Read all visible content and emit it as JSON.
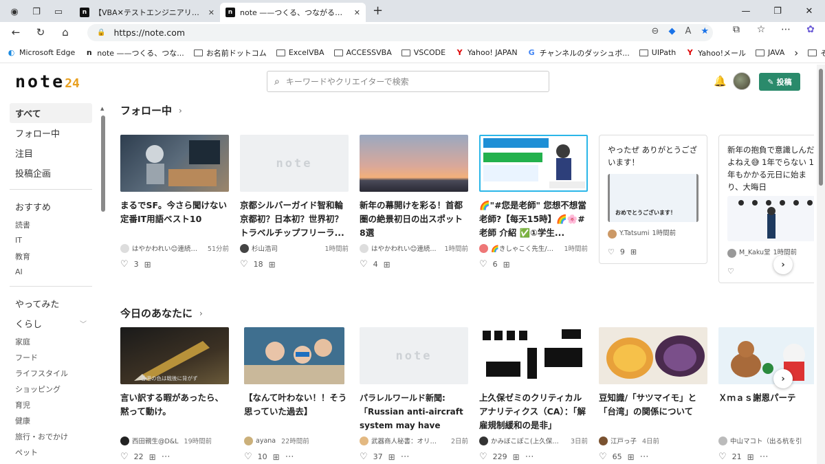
{
  "browser": {
    "tabs": [
      {
        "favicon": "n",
        "title": "【VBA✕テストエンジニアリング】エビデ",
        "active": false
      },
      {
        "favicon": "n",
        "title": "note ——つくる、つながる、とどける。",
        "active": true
      }
    ],
    "url": "https://note.com",
    "bookmarks": [
      {
        "label": "Microsoft Edge",
        "icon": "edge-icon"
      },
      {
        "label": "note ——つくる、つな...",
        "icon": "note-icon"
      },
      {
        "label": "お名前ドットコム",
        "icon": "folder-icon"
      },
      {
        "label": "ExcelVBA",
        "icon": "folder-icon"
      },
      {
        "label": "ACCESSVBA",
        "icon": "folder-icon"
      },
      {
        "label": "VSCODE",
        "icon": "folder-icon"
      },
      {
        "label": "Yahoo! JAPAN",
        "icon": "yahoo-icon"
      },
      {
        "label": "チャンネルのダッシュボ...",
        "icon": "google-icon"
      },
      {
        "label": "UIPath",
        "icon": "folder-icon"
      },
      {
        "label": "Yahoo!メール",
        "icon": "yahoo-icon"
      },
      {
        "label": "JAVA",
        "icon": "folder-icon"
      }
    ],
    "other_favorites": "その他のお気に入り"
  },
  "header": {
    "logo": "note",
    "logo_badge": "24",
    "search_placeholder": "キーワードやクリエイターで検索",
    "post_button": "投稿"
  },
  "sidebar": {
    "main": [
      "すべて",
      "フォロー中",
      "注目",
      "投稿企画"
    ],
    "recommend_heading": "おすすめ",
    "recommend": [
      "読書",
      "IT",
      "教育",
      "AI"
    ],
    "tried": "やってみた",
    "life_heading": "くらし",
    "life": [
      "家庭",
      "フード",
      "ライフスタイル",
      "ショッピング",
      "育児",
      "健康",
      "旅行・おでかけ",
      "ペット"
    ]
  },
  "sections": {
    "following": {
      "title": "フォロー中",
      "cards": [
        {
          "title": "まるでSF。今さら聞けない定番IT用語ベスト10",
          "author": "はやかわれい😊連続起...",
          "time": "51分前",
          "likes": "3"
        },
        {
          "title": "京都シルバーガイド智和輪 京都初？日本初？世界初？トラベルチップフリーラ...",
          "author": "杉山浩司",
          "time": "1時間前",
          "likes": "18"
        },
        {
          "title": "新年の幕開けを彩る！首都圏の絶景初日の出スポット8選",
          "author": "はやかわれい😊連続...",
          "time": "1時間前",
          "likes": "4"
        },
        {
          "title": "🌈\"#您是老師\" 您想不想當老師?【每天15時】🌈🌸#老師 介紹 ✅①学生...",
          "author": "🌈きしゃこく先生/報...",
          "time": "1時間前",
          "likes": "6"
        }
      ],
      "text_cards": [
        {
          "text": "やったぜ ありがとうございます！",
          "image_caption": "おめでとうございます！",
          "author": "Y.Tatsumi",
          "time": "1時間前",
          "likes": "9"
        },
        {
          "text": "新年の抱負で意識しんだよねえ😅 1年でらない 1年もかかる元日に始まり、大晦日",
          "author": "M_Kaku堂",
          "time": "1時間前"
        }
      ]
    },
    "today": {
      "title": "今日のあなたに",
      "cards": [
        {
          "title": "言い訳する暇があったら、黙って動け。",
          "image_caption": "香港の色は戦後に背がず",
          "author": "西田親生@D&L",
          "time": "19時間前",
          "likes": "22"
        },
        {
          "title": "【なんて叶わない！！そう思っていた過去】",
          "author": "ayana",
          "time": "22時間前",
          "likes": "10"
        },
        {
          "title": "パラレルワールド新聞:「Russian anti-aircraft system may have struc...",
          "author": "武器商人秘書：オリガの...",
          "time": "2日前",
          "likes": "37"
        },
        {
          "title": "上久保ゼミのクリティカルアナリティクス（CA）：「解雇規制緩和の是非」",
          "author": "かみぼこぽこ(上久保誠人)",
          "time": "3日前",
          "likes": "229"
        },
        {
          "title": "豆知識/「サツマイモ」と「台湾」の関係について",
          "author": "江戸っ子",
          "time": "4日前",
          "likes": "65"
        },
        {
          "title": "Ｘｍａｓ謝恩パーテ",
          "author": "中山マコト（出る杭を引",
          "likes": "21"
        }
      ]
    }
  },
  "placeholder_logo": "note"
}
